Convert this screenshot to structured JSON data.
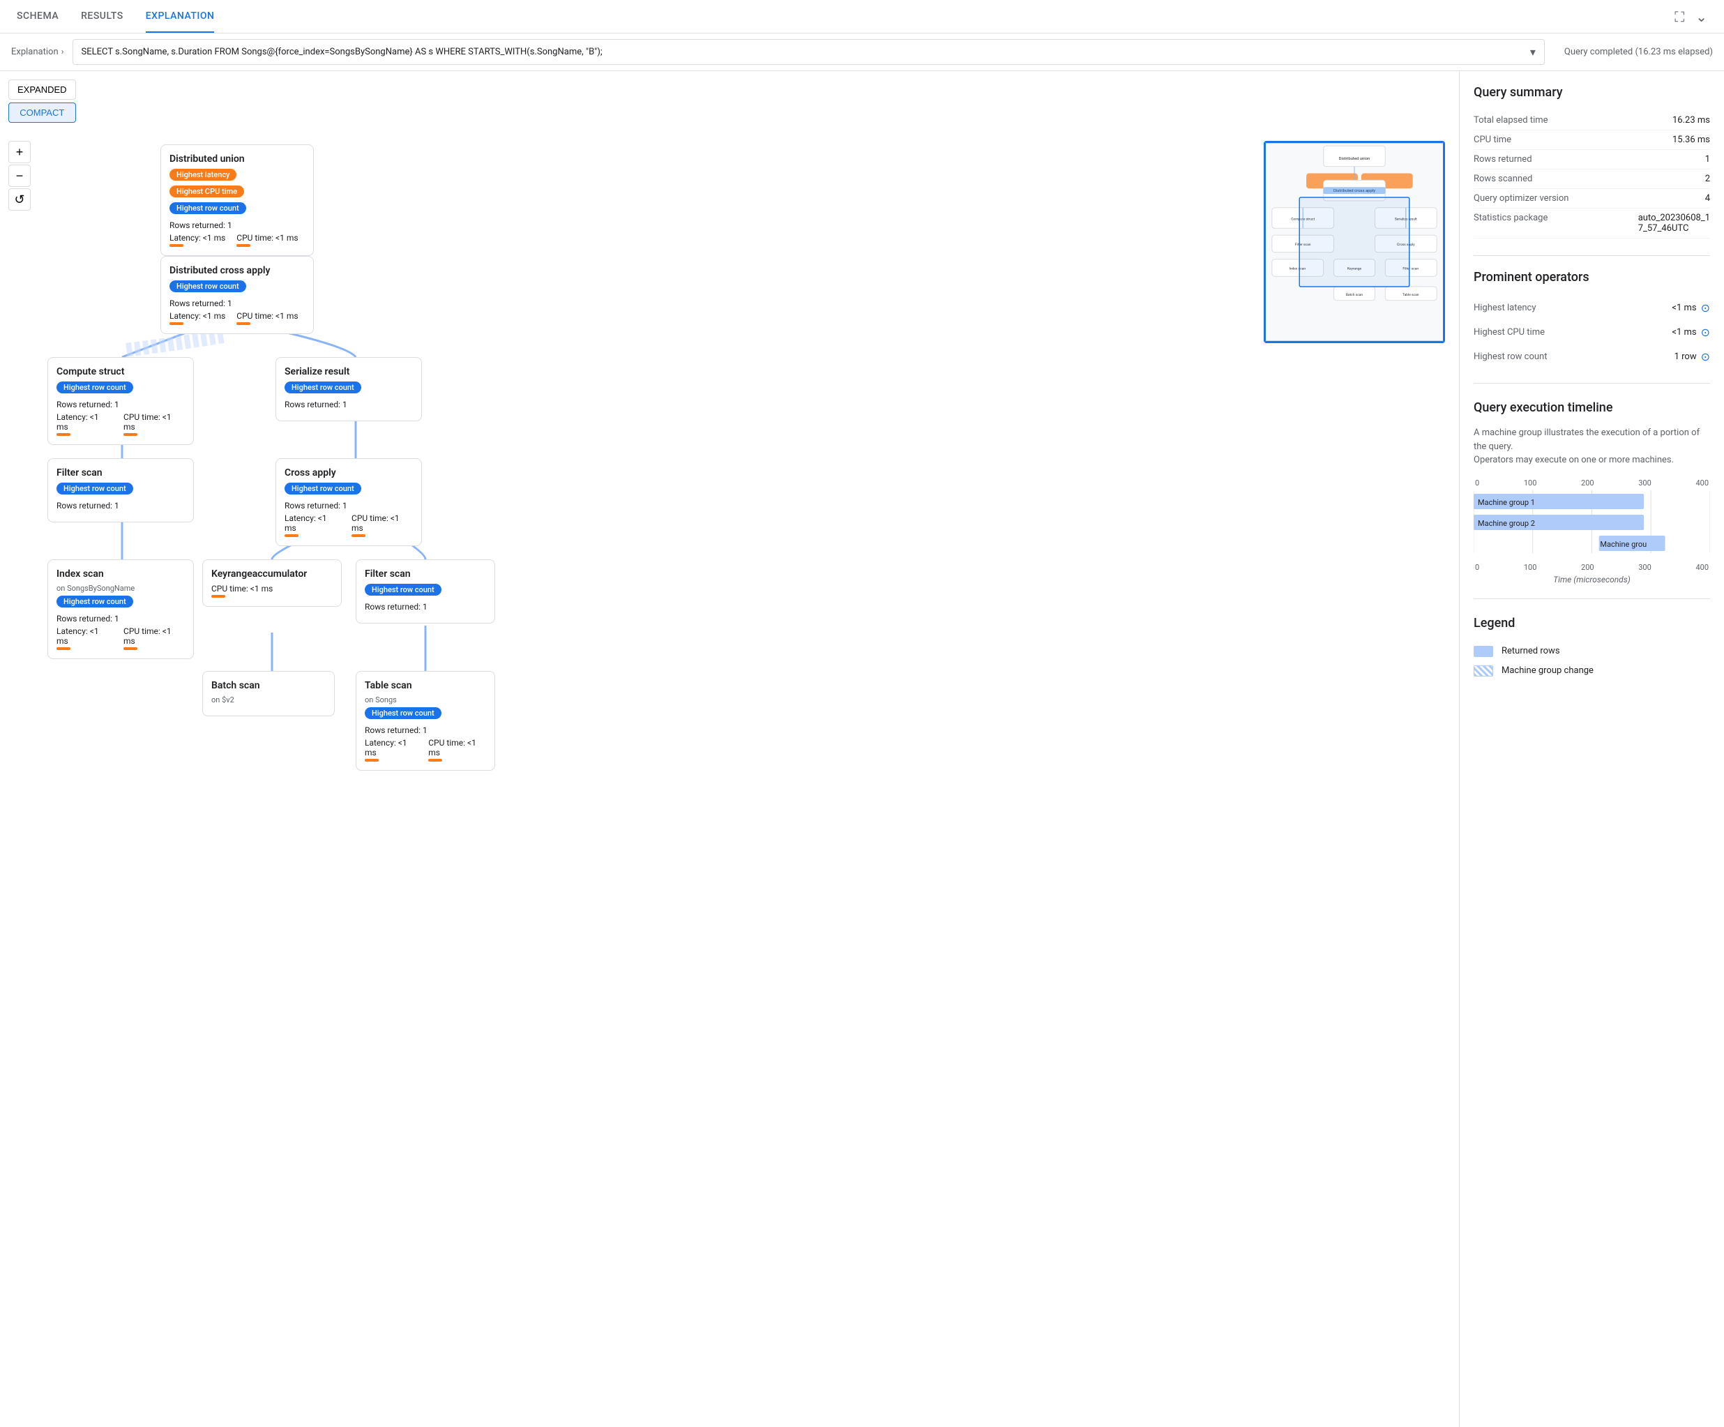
{
  "tabs": [
    {
      "label": "SCHEMA",
      "active": false
    },
    {
      "label": "RESULTS",
      "active": false
    },
    {
      "label": "EXPLANATION",
      "active": true
    }
  ],
  "query_bar": {
    "breadcrumb": "Explanation",
    "query_text": "SELECT s.SongName, s.Duration FROM Songs@{force_index=SongsBySongName} AS s WHERE STARTS_WITH(s.SongName, \"B\");",
    "status": "Query completed (16.23 ms elapsed)"
  },
  "view_buttons": [
    "EXPANDED",
    "COMPACT"
  ],
  "active_view": "COMPACT",
  "zoom_buttons": [
    "+",
    "−",
    "↺"
  ],
  "nodes": {
    "distributed_union": {
      "title": "Distributed union",
      "tags": [
        "Highest latency",
        "Highest CPU time",
        "Highest row count"
      ],
      "rows": "Rows returned: 1",
      "latency": "Latency: <1 ms",
      "cpu": "CPU time: <1 ms"
    },
    "distributed_cross_apply": {
      "title": "Distributed cross apply",
      "tags": [
        "Highest row count"
      ],
      "rows": "Rows returned: 1",
      "latency": "Latency: <1 ms",
      "cpu": "CPU time: <1 ms"
    },
    "compute_struct": {
      "title": "Compute struct",
      "tags": [
        "Highest row count"
      ],
      "rows": "Rows returned: 1",
      "latency": "Latency: <1 ms",
      "cpu": "CPU time: <1 ms"
    },
    "serialize_result": {
      "title": "Serialize result",
      "tags": [
        "Highest row count"
      ],
      "rows": "Rows returned: 1"
    },
    "filter_scan_1": {
      "title": "Filter scan",
      "tags": [
        "Highest row count"
      ],
      "rows": "Rows returned: 1"
    },
    "cross_apply": {
      "title": "Cross apply",
      "tags": [
        "Highest row count"
      ],
      "rows": "Rows returned: 1",
      "latency": "Latency: <1 ms",
      "cpu": "CPU time: <1 ms"
    },
    "index_scan": {
      "title": "Index scan",
      "subtitle": "on SongsBySongName",
      "tags": [
        "Highest row count"
      ],
      "rows": "Rows returned: 1",
      "latency": "Latency: <1 ms",
      "cpu": "CPU time: <1 ms"
    },
    "keyrange_accumulator": {
      "title": "Keyrangeaccumulator",
      "cpu": "CPU time: <1 ms"
    },
    "filter_scan_2": {
      "title": "Filter scan",
      "tags": [
        "Highest row count"
      ],
      "rows": "Rows returned: 1"
    },
    "batch_scan": {
      "title": "Batch scan",
      "subtitle": "on $v2"
    },
    "table_scan": {
      "title": "Table scan",
      "subtitle": "on Songs",
      "tags": [
        "Highest row count"
      ],
      "rows": "Rows returned: 1",
      "latency": "Latency: <1 ms",
      "cpu": "CPU time: <1 ms"
    }
  },
  "query_summary": {
    "title": "Query summary",
    "rows": [
      {
        "label": "Total elapsed time",
        "value": "16.23 ms"
      },
      {
        "label": "CPU time",
        "value": "15.36 ms"
      },
      {
        "label": "Rows returned",
        "value": "1"
      },
      {
        "label": "Rows scanned",
        "value": "2"
      },
      {
        "label": "Query optimizer version",
        "value": "4"
      },
      {
        "label": "Statistics package",
        "value": "auto_20230608_17_57_46UTC"
      }
    ]
  },
  "prominent_operators": {
    "title": "Prominent operators",
    "rows": [
      {
        "label": "Highest latency",
        "value": "<1 ms"
      },
      {
        "label": "Highest CPU time",
        "value": "<1 ms"
      },
      {
        "label": "Highest row count",
        "value": "1 row"
      }
    ]
  },
  "execution_timeline": {
    "title": "Query execution timeline",
    "desc1": "A machine group illustrates the execution of a portion of the query.",
    "desc2": "Operators may execute on one or more machines.",
    "axis_values": [
      "0",
      "100",
      "200",
      "300",
      "400"
    ],
    "axis_label": "Time (microseconds)",
    "bars": [
      {
        "label": "Machine group 1",
        "width_pct": 75,
        "left_pct": 0
      },
      {
        "label": "Machine group 2",
        "width_pct": 75,
        "left_pct": 0
      },
      {
        "label": "Machine grou",
        "width_pct": 30,
        "left_pct": 55
      }
    ]
  },
  "legend": {
    "title": "Legend",
    "items": [
      {
        "label": "Returned rows",
        "type": "rows"
      },
      {
        "label": "Machine group change",
        "type": "machine"
      }
    ]
  }
}
